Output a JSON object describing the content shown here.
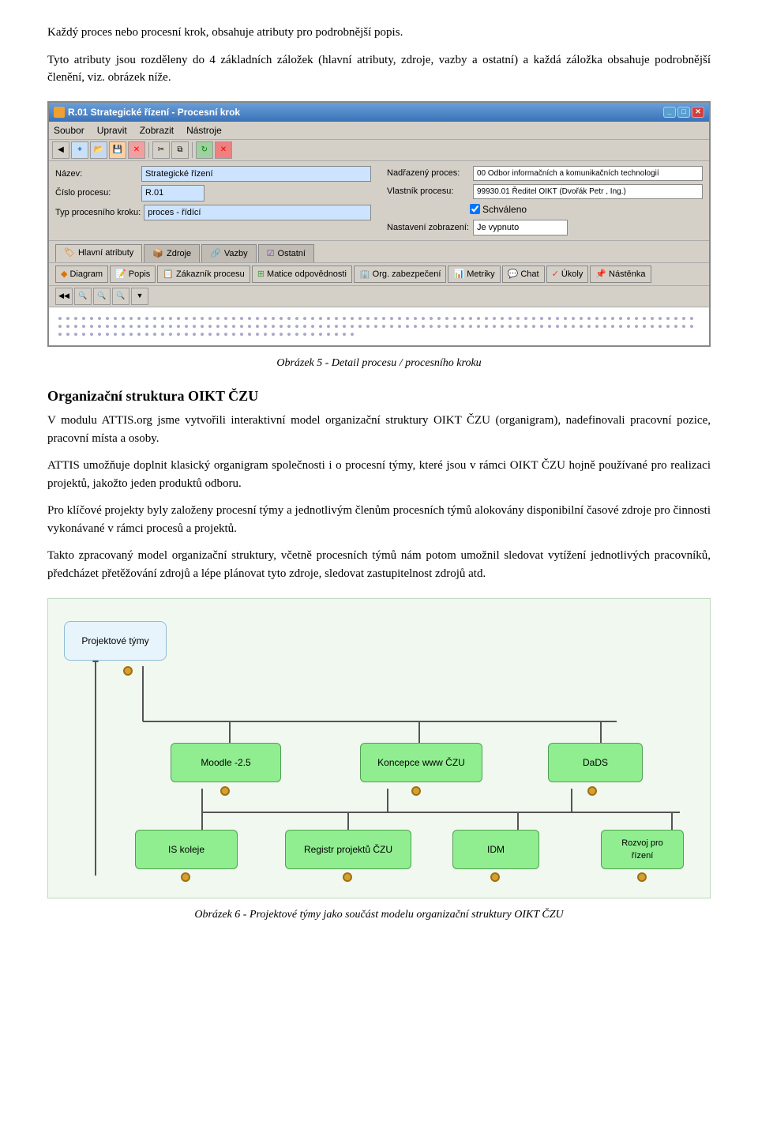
{
  "paragraphs": {
    "p1": "Každý proces nebo procesní krok, obsahuje atributy pro podrobnější popis.",
    "p2": "Tyto atributy jsou rozděleny do 4 základních záložek (hlavní atributy, zdroje, vazby a ostatní) a každá záložka obsahuje podrobnější členění, viz. obrázek níže."
  },
  "window": {
    "title": "R.01 Strategické řízení - Procesní krok",
    "menu": [
      "Soubor",
      "Upravit",
      "Zobrazit",
      "Nástroje"
    ],
    "fields": {
      "nazev_label": "Název:",
      "nazev_value": "Strategické řízení",
      "cislo_label": "Číslo procesu:",
      "cislo_value": "R.01",
      "typ_label": "Typ procesního kroku:",
      "typ_value": "proces - řídící",
      "nadrazeny_label": "Nadřazený proces:",
      "nadrazeny_value": "00 Odbor informačních a komunikačních technologií",
      "vlastnik_label": "Vlastník procesu:",
      "vlastnik_value": "99930.01 Ředitel OIKT (Dvořák Petr , Ing.)",
      "schvaleno_label": "Schváleno",
      "nastaveni_label": "Nastavení zobrazení:",
      "nastaveni_value": "Je vypnuto"
    },
    "tabs": [
      "Hlavní atributy",
      "Zdroje",
      "Vazby",
      "Ostatní"
    ],
    "actions": [
      "Diagram",
      "Popis",
      "Zákazník procesu",
      "Matice odpovědnosti",
      "Org. zabezpečení",
      "Metriky",
      "Chat",
      "Úkoly",
      "Nástěnka"
    ]
  },
  "caption1": "Obrázek 5 - Detail procesu / procesního kroku",
  "heading1": "Organizační struktura OIKT ČZU",
  "paragraphs2": {
    "intro": "V modulu ATTIS.org jsme vytvořili interaktivní model organizační struktury OIKT ČZU (organigram), nadefinovali pracovní pozice, pracovní místa a osoby.",
    "p2": "ATTIS umožňuje doplnit klasický organigram společnosti i o procesní týmy, které jsou v rámci OIKT ČZU hojně používané pro realizaci projektů, jakožto jeden produktů odboru.",
    "p3": "Pro klíčové projekty byly založeny procesní týmy a jednotlivým členům procesních týmů alokovány disponibilní časové zdroje pro činnosti vykonávané v rámci procesů a projektů.",
    "p4": "Takto zpracovaný model organizační struktury, včetně procesních týmů nám potom umožnil sledovat vytížení jednotlivých pracovníků, předcházet přetěžování zdrojů a lépe plánovat tyto zdroje, sledovat zastupitelnost zdrojů atd."
  },
  "diagram": {
    "top_node": "Projektové týmy",
    "row1": [
      "Moodle -2.5",
      "Koncepce www ČZU",
      "DaDS"
    ],
    "row2": [
      "IS koleje",
      "Registr projektů ČZU",
      "IDM",
      "Rozvoj pro\nřízení"
    ]
  },
  "caption2": "Obrázek 6 - Projektové týmy jako součást modelu organizační struktury OIKT ČZU"
}
